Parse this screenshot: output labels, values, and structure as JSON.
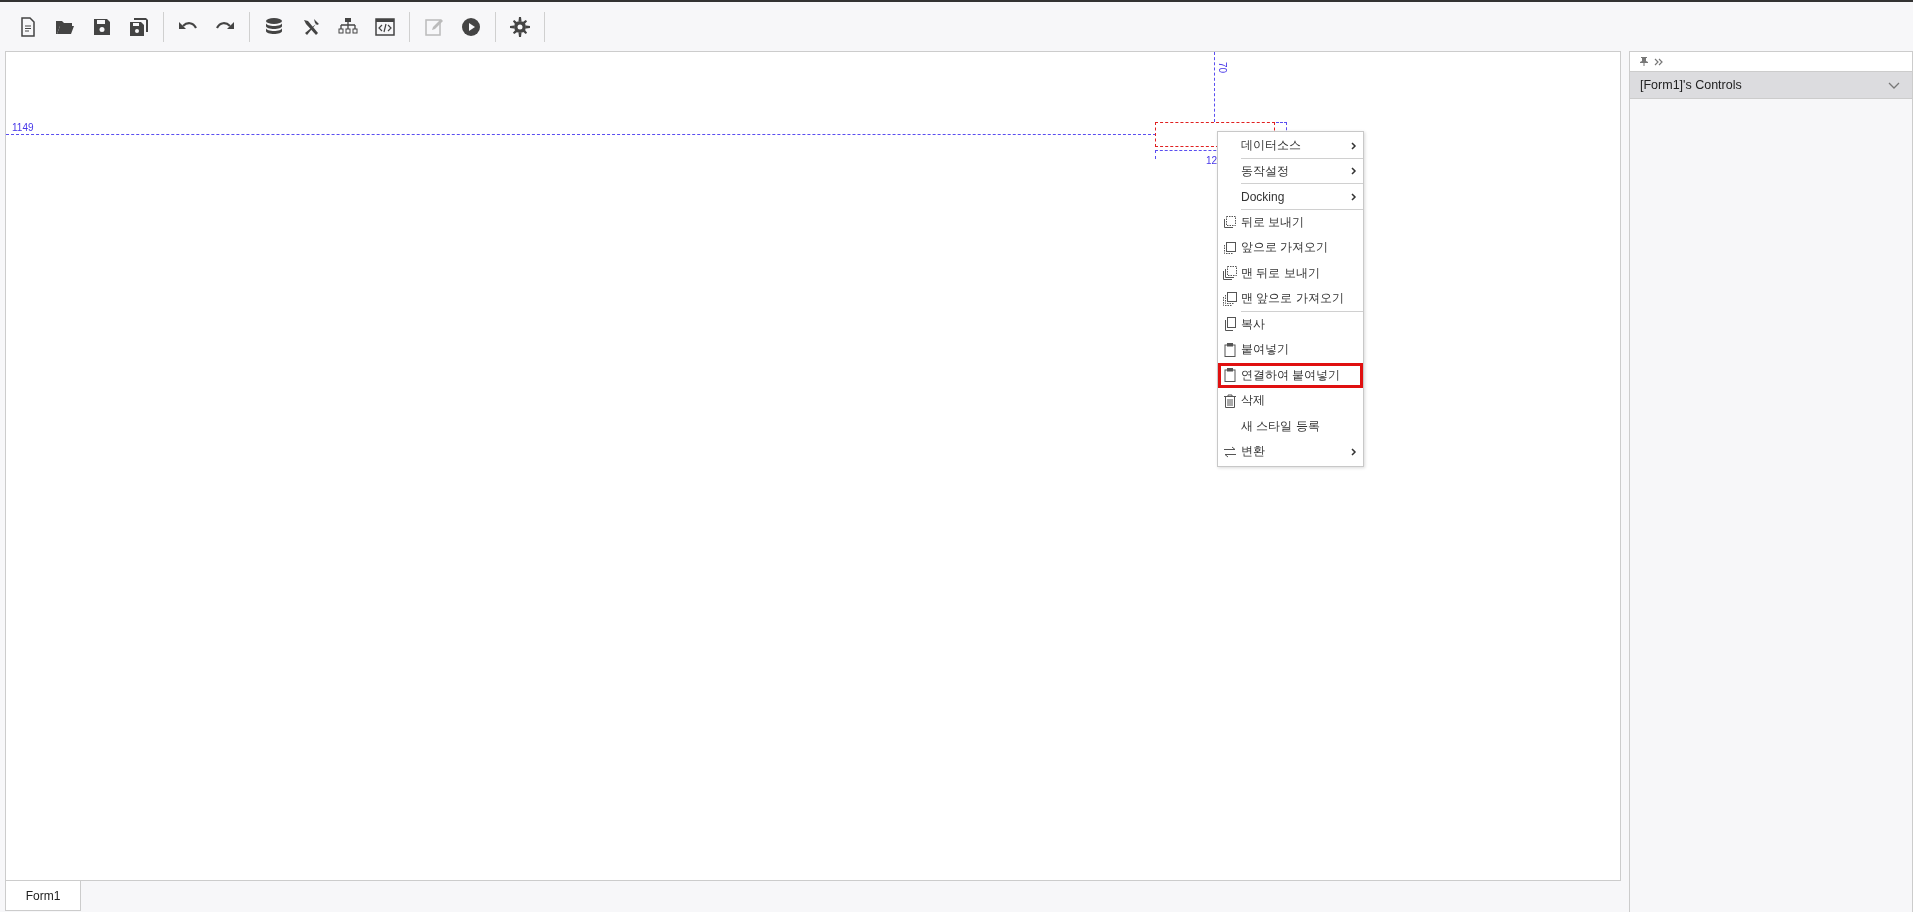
{
  "toolbar": {
    "groups": [
      {
        "buttons": [
          {
            "disabled": false
          },
          {
            "disabled": false
          },
          {
            "disabled": false
          },
          {
            "disabled": false
          }
        ]
      },
      {
        "buttons": [
          {
            "disabled": false
          },
          {
            "disabled": false
          }
        ]
      },
      {
        "buttons": [
          {
            "disabled": false
          },
          {
            "disabled": false
          },
          {
            "disabled": false
          },
          {
            "disabled": false
          }
        ]
      },
      {
        "buttons": [
          {
            "disabled": true
          },
          {
            "disabled": false
          }
        ]
      },
      {
        "buttons": [
          {
            "disabled": false
          }
        ]
      }
    ]
  },
  "canvas": {
    "guides": {
      "left_distance": "1149",
      "top_distance": "70",
      "bottom_label": "12"
    }
  },
  "context_menu": {
    "items": [
      {
        "label": "데이터소스",
        "submenu": true,
        "separator_after": true,
        "selected": false
      },
      {
        "label": "동작설정",
        "submenu": true,
        "separator_after": true,
        "selected": false
      },
      {
        "label": "Docking",
        "submenu": true,
        "separator_after": true,
        "selected": false
      },
      {
        "label": "뒤로 보내기",
        "submenu": false,
        "separator_after": false,
        "selected": false
      },
      {
        "label": "앞으로 가져오기",
        "submenu": false,
        "separator_after": false,
        "selected": false
      },
      {
        "label": "맨 뒤로 보내기",
        "submenu": false,
        "separator_after": false,
        "selected": false
      },
      {
        "label": "맨 앞으로 가져오기",
        "submenu": false,
        "separator_after": true,
        "selected": false
      },
      {
        "label": "복사",
        "submenu": false,
        "separator_after": false,
        "selected": false
      },
      {
        "label": "붙여넣기",
        "submenu": false,
        "separator_after": false,
        "selected": false
      },
      {
        "label": "연결하여 붙여넣기",
        "submenu": false,
        "separator_after": false,
        "selected": true
      },
      {
        "label": "삭제",
        "submenu": false,
        "separator_after": false,
        "selected": false
      },
      {
        "label": "새 스타일 등록",
        "submenu": false,
        "separator_after": false,
        "selected": false
      },
      {
        "label": "변환",
        "submenu": true,
        "separator_after": false,
        "selected": false
      }
    ]
  },
  "side_panel": {
    "title": "[Form1]'s Controls"
  },
  "tabs": [
    {
      "label": "Form1",
      "selected": true
    }
  ]
}
